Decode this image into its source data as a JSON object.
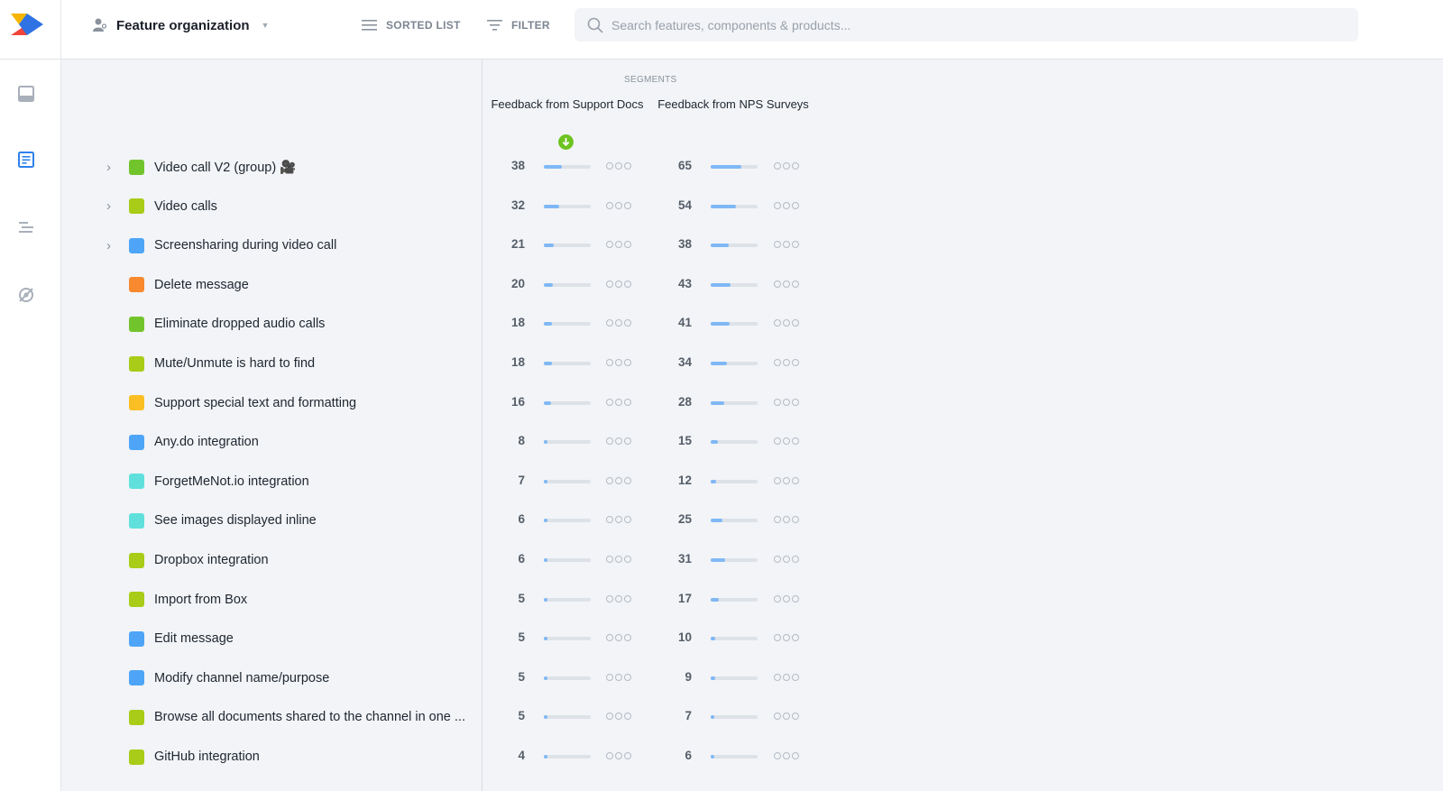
{
  "header": {
    "view_selector_label": "Feature organization",
    "sorted_list_label": "SORTED LIST",
    "filter_label": "FILTER",
    "search_placeholder": "Search features, components & products..."
  },
  "sidebar": {
    "icons": [
      "inbox-icon",
      "notes-icon",
      "roadmap-icon",
      "insights-icon"
    ],
    "active": "notes-icon"
  },
  "segments": {
    "title": "SEGMENTS",
    "columns": [
      {
        "label": "Feedback from Support Docs",
        "sorted": true
      },
      {
        "label": "Feedback from NPS Surveys",
        "sorted": false
      }
    ]
  },
  "features": [
    {
      "name": "Video call V2 (group) 🎥",
      "color": "#72c42c",
      "expandable": true,
      "support": 38,
      "nps": 65
    },
    {
      "name": "Video calls",
      "color": "#a9cc18",
      "expandable": true,
      "support": 32,
      "nps": 54
    },
    {
      "name": "Screensharing during video call",
      "color": "#4ea5f7",
      "expandable": true,
      "support": 21,
      "nps": 38
    },
    {
      "name": "Delete message",
      "color": "#f8892e",
      "expandable": false,
      "support": 20,
      "nps": 43
    },
    {
      "name": "Eliminate dropped audio calls",
      "color": "#72c42c",
      "expandable": false,
      "support": 18,
      "nps": 41
    },
    {
      "name": "Mute/Unmute is hard to find",
      "color": "#a9cc18",
      "expandable": false,
      "support": 18,
      "nps": 34
    },
    {
      "name": "Support special text and formatting",
      "color": "#fbbf24",
      "expandable": false,
      "support": 16,
      "nps": 28
    },
    {
      "name": "Any.do integration",
      "color": "#4ea5f7",
      "expandable": false,
      "support": 8,
      "nps": 15
    },
    {
      "name": "ForgetMeNot.io integration",
      "color": "#5fe0dc",
      "expandable": false,
      "support": 7,
      "nps": 12
    },
    {
      "name": "See images displayed inline",
      "color": "#5fe0dc",
      "expandable": false,
      "support": 6,
      "nps": 25
    },
    {
      "name": "Dropbox integration",
      "color": "#a9cc18",
      "expandable": false,
      "support": 6,
      "nps": 31
    },
    {
      "name": "Import from Box",
      "color": "#a9cc18",
      "expandable": false,
      "support": 5,
      "nps": 17
    },
    {
      "name": "Edit message",
      "color": "#4ea5f7",
      "expandable": false,
      "support": 5,
      "nps": 10
    },
    {
      "name": "Modify channel name/purpose",
      "color": "#4ea5f7",
      "expandable": false,
      "support": 5,
      "nps": 9
    },
    {
      "name": "Browse all documents shared to the channel in one ...",
      "color": "#a9cc18",
      "expandable": false,
      "support": 5,
      "nps": 7
    },
    {
      "name": "GitHub integration",
      "color": "#a9cc18",
      "expandable": false,
      "support": 4,
      "nps": 6
    }
  ],
  "score_max": 100,
  "colors": {
    "accent": "#2f80ed",
    "bar": "#7fb8f5",
    "sort_badge": "#6dc320"
  }
}
